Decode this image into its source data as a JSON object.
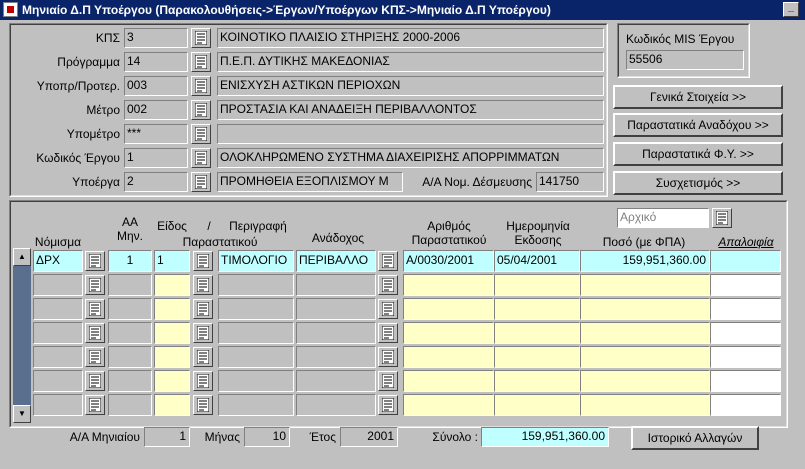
{
  "window": {
    "title": "Μηνιαίο Δ.Π Υποέργου (Παρακολουθήσεις->Έργων/Υποέργων ΚΠΣ->Μηνιαίο Δ.Π Υποέργου)",
    "minimize": "_"
  },
  "header": {
    "kps": {
      "label": "ΚΠΣ",
      "code": "3",
      "desc": "ΚΟΙΝΟΤΙΚΟ ΠΛΑΙΣΙΟ ΣΤΗΡΙΞΗΣ 2000-2006"
    },
    "programma": {
      "label": "Πρόγραμμα",
      "code": "14",
      "desc": "Π.Ε.Π. ΔΥΤΙΚΗΣ ΜΑΚΕΔΟΝΙΑΣ"
    },
    "ypopr": {
      "label": "Υποπρ/Προτερ.",
      "code": "003",
      "desc": "ΕΝΙΣΧΥΣΗ ΑΣΤΙΚΩΝ ΠΕΡΙΟΧΩΝ"
    },
    "metro": {
      "label": "Μέτρο",
      "code": "002",
      "desc": "ΠΡΟΣΤΑΣΙΑ ΚΑΙ ΑΝΑΔΕΙΞΗ ΠΕΡΙΒΑΛΛΟΝΤΟΣ"
    },
    "ypometro": {
      "label": "Υπομέτρο",
      "code": "***",
      "desc": ""
    },
    "ergo": {
      "label": "Κωδικός Έργου",
      "code": "1",
      "desc": "ΟΛΟΚΛΗΡΩΜΕΝΟ ΣΥΣΤΗΜΑ ΔΙΑΧΕΙΡΙΣΗΣ ΑΠΟΡΡΙΜΜΑΤΩΝ"
    },
    "ypoerga": {
      "label": "Υποέργα",
      "code": "2",
      "desc": "ΠΡΟΜΗΘΕΙΑ ΕΞΟΠΛΙΣΜΟΥ Μ"
    },
    "desmeysi": {
      "label": "Α/Α Νομ. Δέσμευσης",
      "value": "141750"
    }
  },
  "mis": {
    "label": "Κωδικός MIS Έργου",
    "value": "55506"
  },
  "buttons": {
    "general": "Γενικά Στοιχεία >>",
    "anadoxou": "Παραστατικά Αναδόχου >>",
    "fy": "Παραστατικά Φ.Υ. >>",
    "sysxetismos": "Συσχετισμός >>",
    "history": "Ιστορικό Αλλαγών"
  },
  "grid": {
    "filter": "Αρχικό",
    "columns": {
      "nomisma": "Νόμισμα",
      "aa": "ΑΑ\nΜην.",
      "eidos": "Είδος",
      "perigrafi": "Περιγραφή",
      "slash": "/",
      "parastatikou": "Παραστατικού",
      "anadoxos": "Ανάδοχος",
      "arithmos": "Αριθμός\nΠαραστατικού",
      "imerominia": "Ημερομηνία\nΕκδοσης",
      "poso": "Ποσό (με ΦΠΑ)",
      "apaloifia": "Απαλοιφία"
    },
    "rows": [
      {
        "nomisma": "ΔΡΧ",
        "aa": "1",
        "eidos": "1",
        "perigrafi": "ΤΙΜΟΛΟΓΙΟ",
        "anadoxos": "ΠΕΡΙΒΑΛΛΟ",
        "arithmos": "Α/0030/2001",
        "imerominia": "05/04/2001",
        "poso": "159,951,360.00",
        "apaloifia": ""
      },
      {
        "nomisma": "",
        "aa": "",
        "eidos": "",
        "perigrafi": "",
        "anadoxos": "",
        "arithmos": "",
        "imerominia": "",
        "poso": "",
        "apaloifia": ""
      },
      {
        "nomisma": "",
        "aa": "",
        "eidos": "",
        "perigrafi": "",
        "anadoxos": "",
        "arithmos": "",
        "imerominia": "",
        "poso": "",
        "apaloifia": ""
      },
      {
        "nomisma": "",
        "aa": "",
        "eidos": "",
        "perigrafi": "",
        "anadoxos": "",
        "arithmos": "",
        "imerominia": "",
        "poso": "",
        "apaloifia": ""
      },
      {
        "nomisma": "",
        "aa": "",
        "eidos": "",
        "perigrafi": "",
        "anadoxos": "",
        "arithmos": "",
        "imerominia": "",
        "poso": "",
        "apaloifia": ""
      },
      {
        "nomisma": "",
        "aa": "",
        "eidos": "",
        "perigrafi": "",
        "anadoxos": "",
        "arithmos": "",
        "imerominia": "",
        "poso": "",
        "apaloifia": ""
      },
      {
        "nomisma": "",
        "aa": "",
        "eidos": "",
        "perigrafi": "",
        "anadoxos": "",
        "arithmos": "",
        "imerominia": "",
        "poso": "",
        "apaloifia": ""
      }
    ]
  },
  "footer": {
    "aa_label": "Α/Α Μηνιαίου",
    "aa_value": "1",
    "minas_label": "Μήνας",
    "minas_value": "10",
    "etos_label": "Έτος",
    "etos_value": "2001",
    "synolo_label": "Σύνολο :",
    "synolo_value": "159,951,360.00"
  },
  "icons": {
    "lov": "list-icon",
    "scroll_up": "▲",
    "scroll_down": "▼"
  }
}
